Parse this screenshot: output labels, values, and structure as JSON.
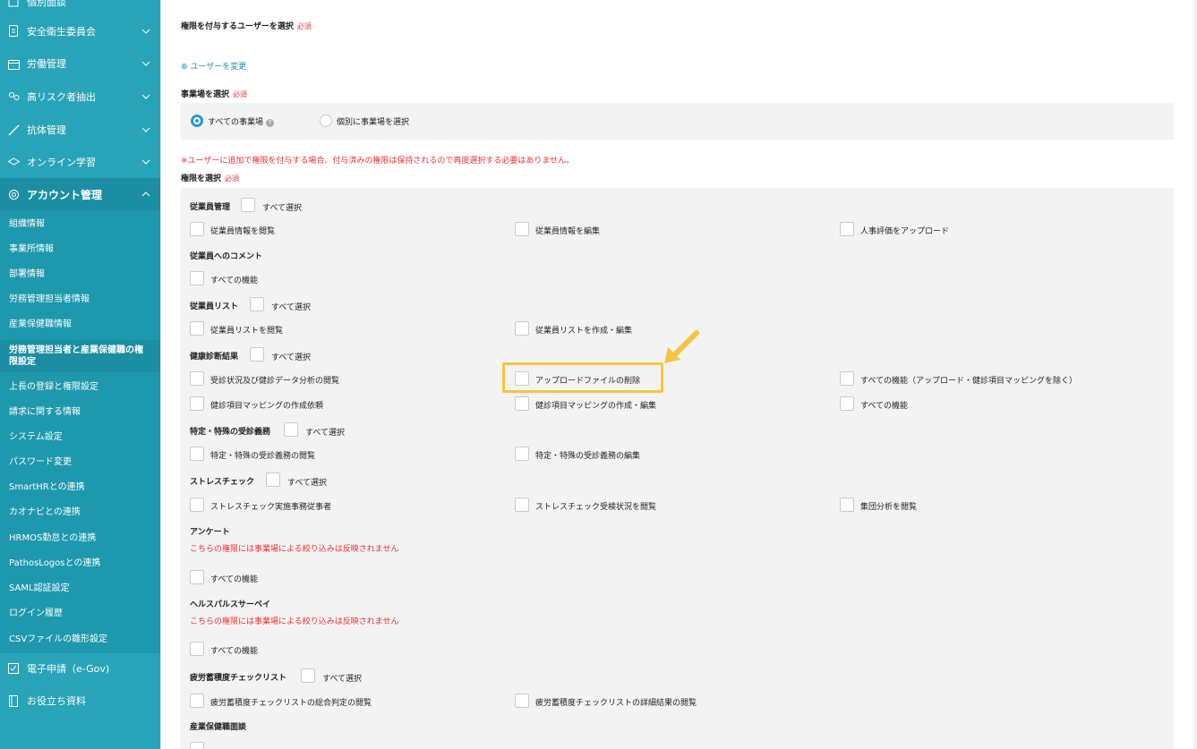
{
  "sidebar": {
    "top_partial": "個別面談",
    "items": [
      {
        "label": "安全衛生委員会",
        "icon": "document-icon"
      },
      {
        "label": "労働管理",
        "icon": "calendar-icon"
      },
      {
        "label": "高リスク者抽出",
        "icon": "people-icon"
      },
      {
        "label": "抗体管理",
        "icon": "syringe-icon"
      },
      {
        "label": "オンライン学習",
        "icon": "graduation-icon"
      },
      {
        "label": "アカウント管理",
        "icon": "gear-icon"
      }
    ],
    "sub_items": [
      "組織情報",
      "事業所情報",
      "部署情報",
      "労務管理担当者情報",
      "産業保健職情報",
      "労務管理担当者と産業保健職の権限設定",
      "上長の登録と権限設定",
      "請求に関する情報",
      "システム設定",
      "パスワード変更",
      "SmartHRとの連携",
      "カオナビとの連携",
      "HRMOS勤怠との連携",
      "PathosLogosとの連携",
      "SAML認証設定",
      "ログイン履歴",
      "CSVファイルの雛形設定"
    ],
    "bottom_items": [
      {
        "label": "電子申請（e-Gov)",
        "icon": "checkbox-icon"
      },
      {
        "label": "お役立ち資料",
        "icon": "book-icon"
      }
    ]
  },
  "main": {
    "select_user_label": "権限を付与するユーザーを選択",
    "required": "必須",
    "change_user_link": "ユーザーを変更",
    "select_site_label": "事業場を選択",
    "site_options": [
      "すべての事業場",
      "個別に事業場を選択"
    ],
    "notice": "※ユーザーに追加で権限を付与する場合、付与済みの権限は保持されるので再度選択する必要はありません。",
    "select_permission_label": "権限を選択",
    "select_all": "すべて選択",
    "groups": {
      "employee_mgmt": {
        "title": "従業員管理",
        "items": [
          "従業員情報を閲覧",
          "従業員情報を編集",
          "人事評価をアップロード"
        ]
      },
      "employee_comment": {
        "title": "従業員へのコメント",
        "items": [
          "すべての機能"
        ]
      },
      "employee_list": {
        "title": "従業員リスト",
        "items": [
          "従業員リストを閲覧",
          "従業員リストを作成・編集"
        ]
      },
      "health_check": {
        "title": "健康診断結果",
        "items": [
          "受診状況及び健診データ分析の閲覧",
          "アップロードファイルの削除",
          "すべての機能（アップロード・健診項目マッピングを除く）",
          "健診項目マッピングの作成依頼",
          "健診項目マッピングの作成・編集",
          "すべての機能"
        ]
      },
      "special_exam": {
        "title": "特定・特殊の受診義務",
        "items": [
          "特定・特殊の受診義務の閲覧",
          "特定・特殊の受診義務の編集"
        ]
      },
      "stress_check": {
        "title": "ストレスチェック",
        "items": [
          "ストレスチェック実施事務従事者",
          "ストレスチェック受検状況を閲覧",
          "集団分析を閲覧"
        ]
      },
      "survey": {
        "title": "アンケート",
        "note": "こちらの権限には事業場による絞り込みは反映されません",
        "items": [
          "すべての機能"
        ]
      },
      "health_pulse": {
        "title": "ヘルスパルスサーベイ",
        "note": "こちらの権限には事業場による絞り込みは反映されません",
        "items": [
          "すべての機能"
        ]
      },
      "fatigue": {
        "title": "疲労蓄積度チェックリスト",
        "items": [
          "疲労蓄積度チェックリストの総合判定の閲覧",
          "疲労蓄積度チェックリストの詳細結果の閲覧"
        ]
      },
      "occupational": {
        "title": "産業保健職面談"
      }
    }
  },
  "colors": {
    "sidebar": "#29a3b8",
    "highlight": "#f5c542",
    "required": "#e33333",
    "link": "#2a8fa8"
  }
}
